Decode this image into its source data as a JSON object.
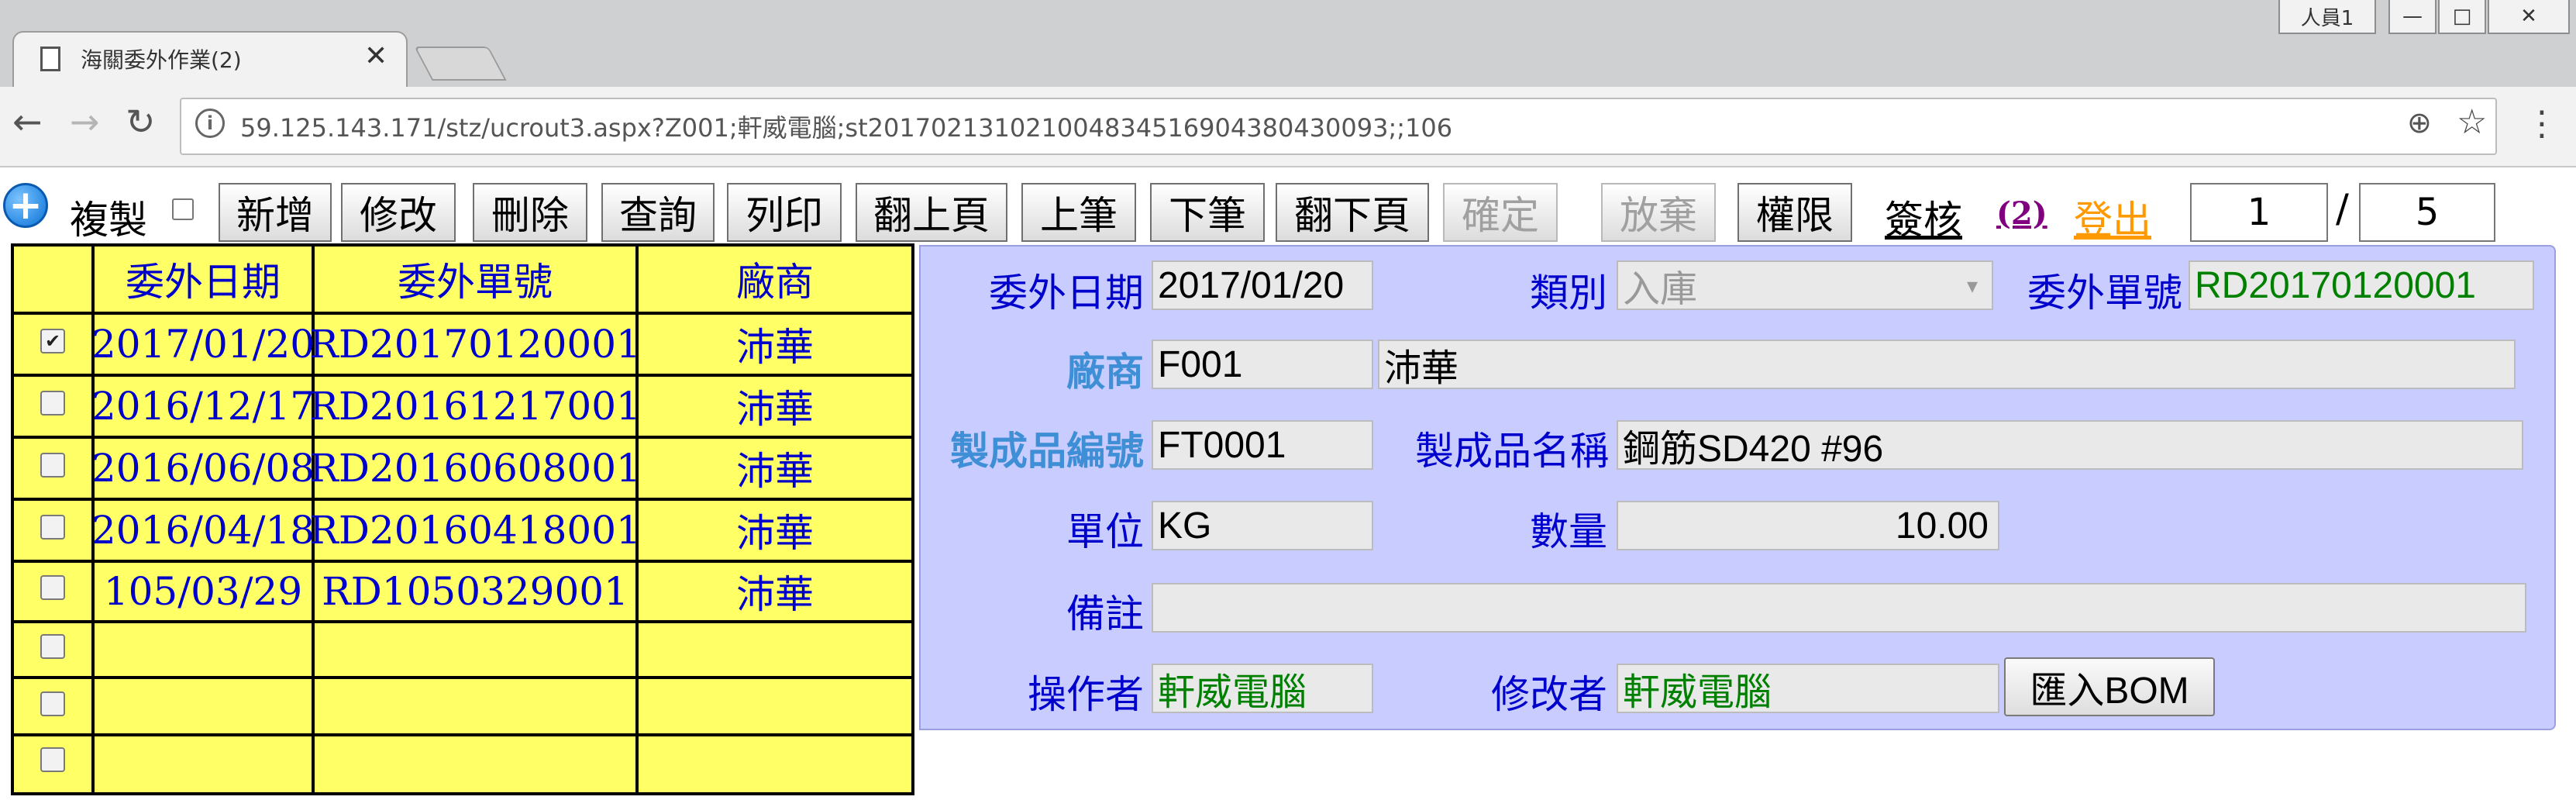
{
  "browser": {
    "user_button": "人員1",
    "min_symbol": "—",
    "max_symbol": "□",
    "close_symbol": "✕",
    "tab_title": "海關委外作業(2)",
    "tab_close": "✕",
    "url": "59.125.143.171/stz/ucrout3.aspx?Z001;軒威電腦;st20170213102100483451690438043​0093;;106",
    "back": "←",
    "forward": "→",
    "reload": "↻",
    "info": "i",
    "zoom": "⊕",
    "star": "☆",
    "menu": "⋮"
  },
  "toolbar": {
    "add_symbol": "+",
    "copy_label": "複製",
    "buttons": {
      "new": "新增",
      "edit": "修改",
      "delete": "刪除",
      "query": "查詢",
      "print": "列印",
      "page_up": "翻上頁",
      "prev": "上筆",
      "next": "下筆",
      "page_down": "翻下頁",
      "confirm": "確定",
      "discard": "放棄",
      "permission": "權限"
    },
    "review_label": "簽核",
    "review_count": "(2)",
    "logout_label": "登出",
    "page_current": "1",
    "page_sep": "/",
    "page_total": "5"
  },
  "list": {
    "headers": [
      "委外日期",
      "委外單號",
      "廠商"
    ],
    "rows": [
      {
        "checked": "✔",
        "date": "2017/01/20",
        "number": "RD20170120001",
        "vendor": "沛華"
      },
      {
        "checked": "",
        "date": "2016/12/17",
        "number": "RD20161217001",
        "vendor": "沛華"
      },
      {
        "checked": "",
        "date": "2016/06/08",
        "number": "RD20160608001",
        "vendor": "沛華"
      },
      {
        "checked": "",
        "date": "2016/04/18",
        "number": "RD20160418001",
        "vendor": "沛華"
      },
      {
        "checked": "",
        "date": "105/03/29",
        "number": "RD1050329001",
        "vendor": "沛華"
      },
      {
        "checked": "",
        "date": "",
        "number": "",
        "vendor": ""
      },
      {
        "checked": "",
        "date": "",
        "number": "",
        "vendor": ""
      },
      {
        "checked": "",
        "date": "",
        "number": "",
        "vendor": ""
      }
    ]
  },
  "form": {
    "date_label": "委外日期",
    "date_value": "2017/01/20",
    "type_label": "類別",
    "type_value": "入庫",
    "type_arrow": "▾",
    "number_label": "委外單號",
    "number_value": "RD20170120001",
    "vendor_label": "廠商",
    "vendor_code": "F001",
    "vendor_name": "沛華",
    "product_no_label": "製成品編號",
    "product_no_value": "FT0001",
    "product_name_label": "製成品名稱",
    "product_name_value": "鋼筋SD420 #96",
    "unit_label": "單位",
    "unit_value": "KG",
    "qty_label": "數量",
    "qty_value": "10.00",
    "remark_label": "備註",
    "remark_value": "",
    "operator_label": "操作者",
    "operator_value": "軒威電腦",
    "modifier_label": "修改者",
    "modifier_value": "軒威電腦",
    "import_bom": "匯入BOM"
  }
}
